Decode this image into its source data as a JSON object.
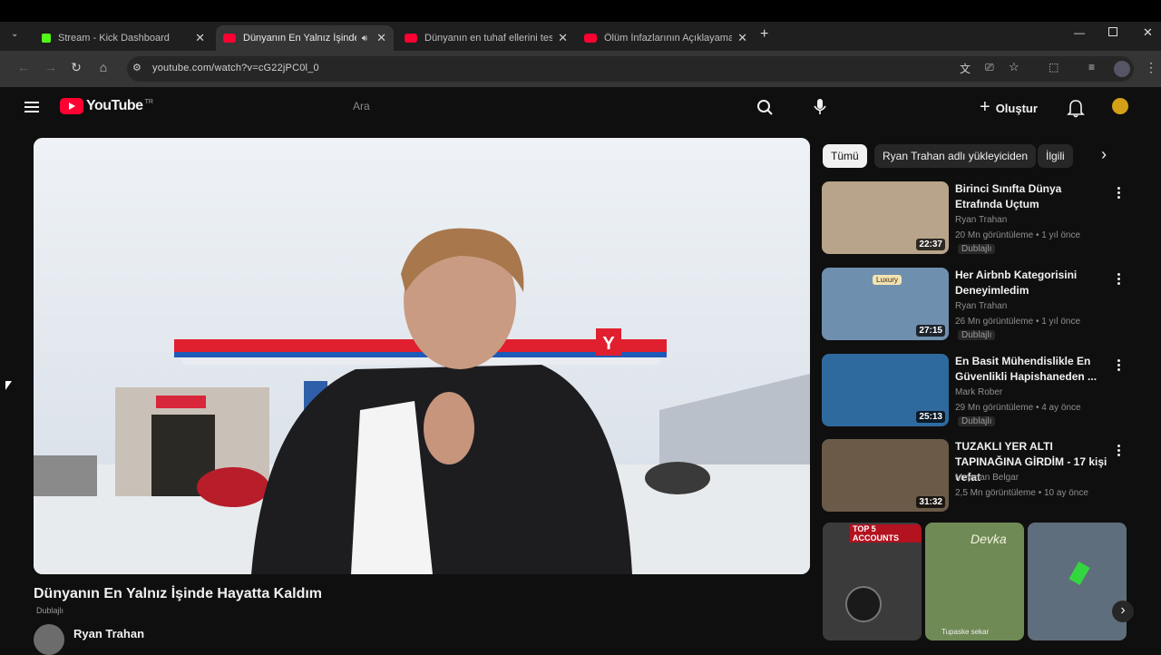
{
  "browser": {
    "tabs": [
      {
        "title": "Stream - Kick Dashboard",
        "favicon_color": "#53fc18"
      },
      {
        "title": "Dünyanın En Yalnız İşinde Hayatta Kaldım",
        "favicon_color": "#ff0033"
      },
      {
        "title": "Dünyanın en tuhaf ellerini test ettim",
        "favicon_color": "#ff0033"
      },
      {
        "title": "Ölüm İnfazlarının Açıklayamadığı",
        "favicon_color": "#ff0033"
      }
    ],
    "url": "youtube.com/watch?v=cG22jPC0l_0"
  },
  "header": {
    "logo_text": "YouTube",
    "logo_suffix": "TR",
    "search_placeholder": "Ara",
    "create_label": "Oluştur"
  },
  "video": {
    "title": "Dünyanın En Yalnız İşinde Hayatta Kaldım",
    "dub_label": "Dublajlı",
    "channel": "Ryan Trahan",
    "station_sign": "Y"
  },
  "chips": [
    "Tümü",
    "Ryan Trahan adlı yükleyiciden",
    "İlgili"
  ],
  "recommendations": [
    {
      "title": "Birinci Sınıfta Dünya Etrafında Uçtum",
      "channel": "Ryan Trahan",
      "meta": "20 Mn görüntüleme • 1 yıl önce",
      "duration": "22:37",
      "badge": "Dublajlı",
      "thumb_color": "#b8a48a"
    },
    {
      "title": "Her Airbnb Kategorisini Deneyimledim",
      "channel": "Ryan Trahan",
      "meta": "26 Mn görüntüleme • 1 yıl önce",
      "duration": "27:15",
      "badge": "Dublajlı",
      "thumb_color": "#6f8fae",
      "thumb_text": "Luxury"
    },
    {
      "title": "En Basit Mühendislikle En Güvenlikli Hapishaneden ...",
      "channel": "Mark Rober",
      "meta": "29 Mn görüntüleme • 4 ay önce",
      "duration": "25:13",
      "badge": "Dublajlı",
      "thumb_color": "#2f6a9e"
    },
    {
      "title": "TUZAKLI YER ALTI TAPINAĞINA GİRDİM - 17 kişi vefat",
      "channel": "Meyman Belgar",
      "meta": "2,5 Mn görüntüleme • 10 ay önce",
      "duration": "31:32",
      "badge": "",
      "thumb_color": "#6b5a48"
    }
  ],
  "shorts": [
    {
      "label": "TOP 5 ACCOUNTS",
      "color": "#3b3b3b"
    },
    {
      "label": "Devka",
      "color": "#6f8a55"
    },
    {
      "label": "",
      "color": "#5f6e7c"
    }
  ],
  "shorts_caption": "Tupaske sekar"
}
